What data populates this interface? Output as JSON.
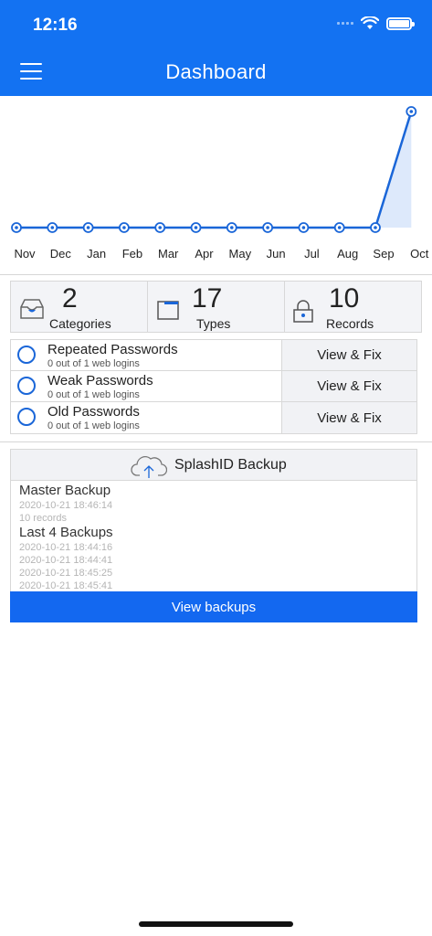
{
  "status_bar": {
    "time": "12:16"
  },
  "header": {
    "title": "Dashboard"
  },
  "chart_data": {
    "type": "line",
    "categories": [
      "Nov",
      "Dec",
      "Jan",
      "Feb",
      "Mar",
      "Apr",
      "May",
      "Jun",
      "Jul",
      "Aug",
      "Sep",
      "Oct"
    ],
    "values": [
      0,
      0,
      0,
      0,
      0,
      0,
      0,
      0,
      0,
      0,
      0,
      10
    ],
    "ylim": [
      0,
      10
    ],
    "grid": false,
    "color": "#1a66d8",
    "fill_color": "#dde9fb"
  },
  "stats": [
    {
      "value": "2",
      "label": "Categories",
      "icon": "tray-icon"
    },
    {
      "value": "17",
      "label": "Types",
      "icon": "folder-icon"
    },
    {
      "value": "10",
      "label": "Records",
      "icon": "lock-icon"
    }
  ],
  "issues": [
    {
      "title": "Repeated Passwords",
      "subtitle": "0 out of 1 web logins",
      "action": "View & Fix"
    },
    {
      "title": "Weak Passwords",
      "subtitle": "0 out of 1 web logins",
      "action": "View & Fix"
    },
    {
      "title": "Old Passwords",
      "subtitle": "0 out of 1 web logins",
      "action": "View & Fix"
    }
  ],
  "backup": {
    "title": "SplashID Backup",
    "master_label": "Master Backup",
    "master_date": "2020-10-21 18:46:14",
    "master_records": "10 records",
    "recent_label": "Last 4 Backups",
    "recent": [
      "2020-10-21 18:44:16",
      "2020-10-21 18:44:41",
      "2020-10-21 18:45:25",
      "2020-10-21 18:45:41"
    ],
    "button_label": "View backups"
  },
  "colors": {
    "accent": "#1372f2",
    "button": "#1368f0"
  }
}
